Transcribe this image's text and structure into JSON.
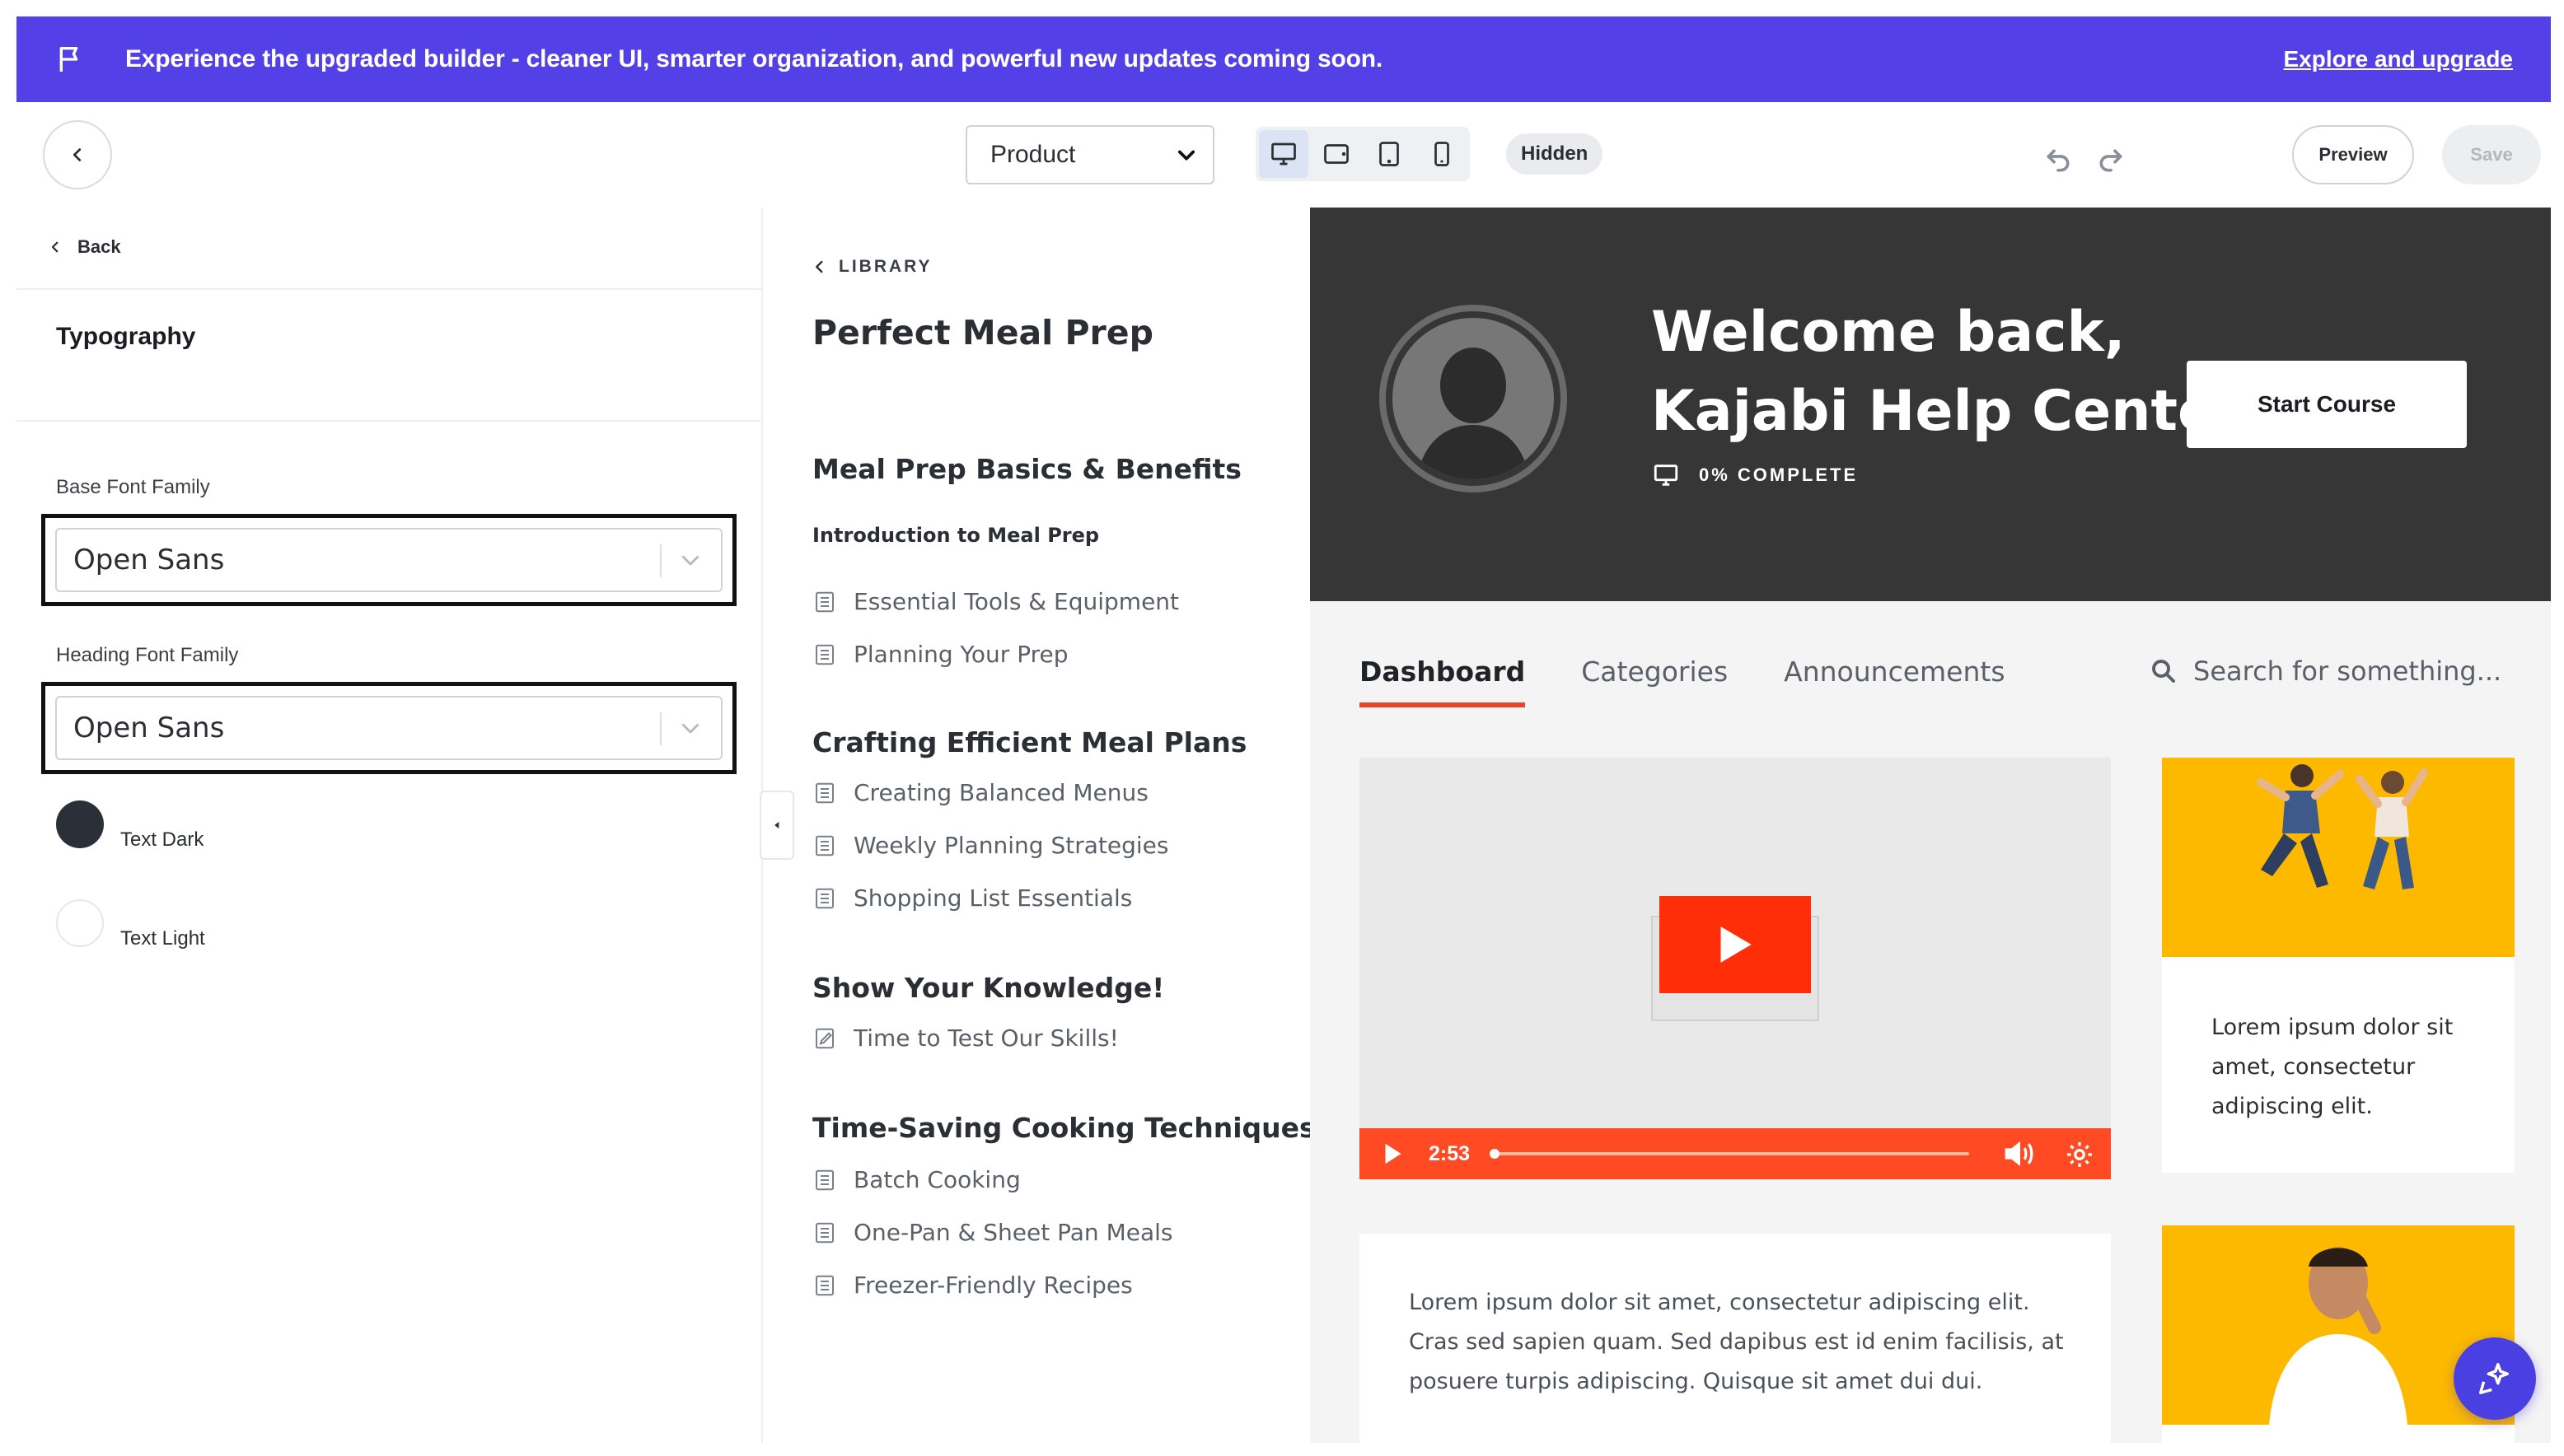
{
  "banner": {
    "message": "Experience the upgraded builder - cleaner UI, smarter organization, and powerful new updates coming soon.",
    "cta": "Explore and upgrade",
    "color": "#5340e6"
  },
  "toolbar": {
    "page_select": "Product",
    "devices": [
      "desktop-icon",
      "tablet-landscape-icon",
      "tablet-portrait-icon",
      "mobile-icon"
    ],
    "active_device": "desktop",
    "visibility": "Hidden",
    "preview": "Preview",
    "save": "Save"
  },
  "settings": {
    "back": "Back",
    "title": "Typography",
    "base_font_label": "Base Font Family",
    "base_font_value": "Open Sans",
    "heading_font_label": "Heading Font Family",
    "heading_font_value": "Open Sans",
    "colors": [
      {
        "label": "Text Dark",
        "hex": "#2b3038"
      },
      {
        "label": "Text Light",
        "hex": "#ffffff"
      }
    ]
  },
  "course_nav": {
    "library": "LIBRARY",
    "title": "Perfect Meal Prep",
    "modules": [
      {
        "title": "Meal Prep Basics & Benefits",
        "sub": "Introduction to Meal Prep",
        "lessons": [
          "Essential Tools & Equipment",
          "Planning Your Prep"
        ]
      },
      {
        "title": "Crafting Efficient Meal Plans",
        "lessons": [
          "Creating Balanced Menus",
          "Weekly Planning Strategies",
          "Shopping List Essentials"
        ]
      },
      {
        "title": "Show Your Knowledge!",
        "lessons": [
          "Time to Test Our Skills!"
        ]
      },
      {
        "title": "Time-Saving Cooking Techniques",
        "lessons": [
          "Batch Cooking",
          "One-Pan & Sheet Pan Meals",
          "Freezer-Friendly Recipes"
        ]
      }
    ]
  },
  "preview": {
    "welcome_line1": "Welcome back,",
    "welcome_line2": "Kajabi Help Center",
    "progress": "0% COMPLETE",
    "start_button": "Start Course",
    "tabs": [
      "Dashboard",
      "Categories",
      "Announcements"
    ],
    "active_tab": "Dashboard",
    "search_placeholder": "Search for something...",
    "video_time": "2:53",
    "body_text": "Lorem ipsum dolor sit amet, consectetur adipiscing elit. Cras sed sapien quam. Sed dapibus est id enim facilisis, at posuere turpis adipiscing. Quisque sit amet dui dui.",
    "card_text": "Lorem ipsum dolor sit amet, consectetur adipiscing elit.",
    "accent": "#e8432c",
    "hero_bg": "#363636"
  }
}
